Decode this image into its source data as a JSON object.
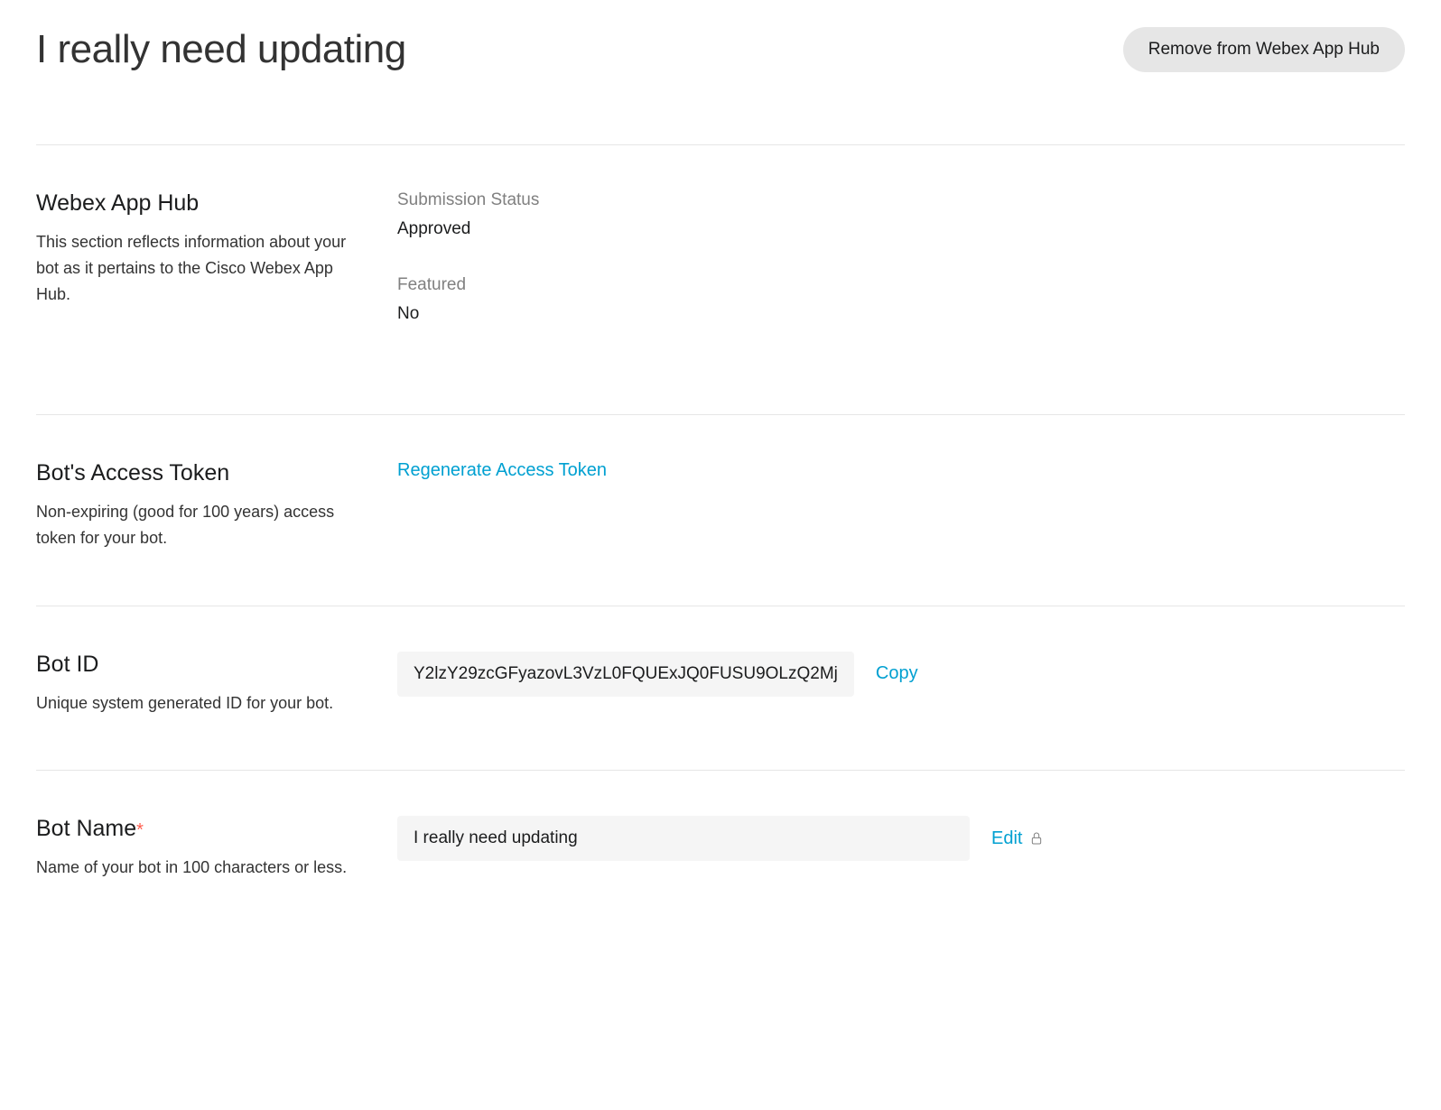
{
  "header": {
    "title": "I really need updating",
    "remove_button_label": "Remove from Webex App Hub"
  },
  "sections": {
    "app_hub": {
      "title": "Webex App Hub",
      "description": "This section reflects information about your bot as it pertains to the Cisco Webex App Hub.",
      "submission_status_label": "Submission Status",
      "submission_status_value": "Approved",
      "featured_label": "Featured",
      "featured_value": "No"
    },
    "access_token": {
      "title": "Bot's Access Token",
      "description": "Non-expiring (good for 100 years) access token for your bot.",
      "regenerate_label": "Regenerate Access Token"
    },
    "bot_id": {
      "title": "Bot ID",
      "description": "Unique system generated ID for your bot.",
      "value": "Y2lzY29zcGFyazovL3VzL0FQUExJQ0FUSU9OLzQ2Mj",
      "copy_label": "Copy"
    },
    "bot_name": {
      "title": "Bot Name",
      "description": "Name of your bot in 100 characters or less.",
      "value": "I really need updating",
      "edit_label": "Edit"
    }
  }
}
